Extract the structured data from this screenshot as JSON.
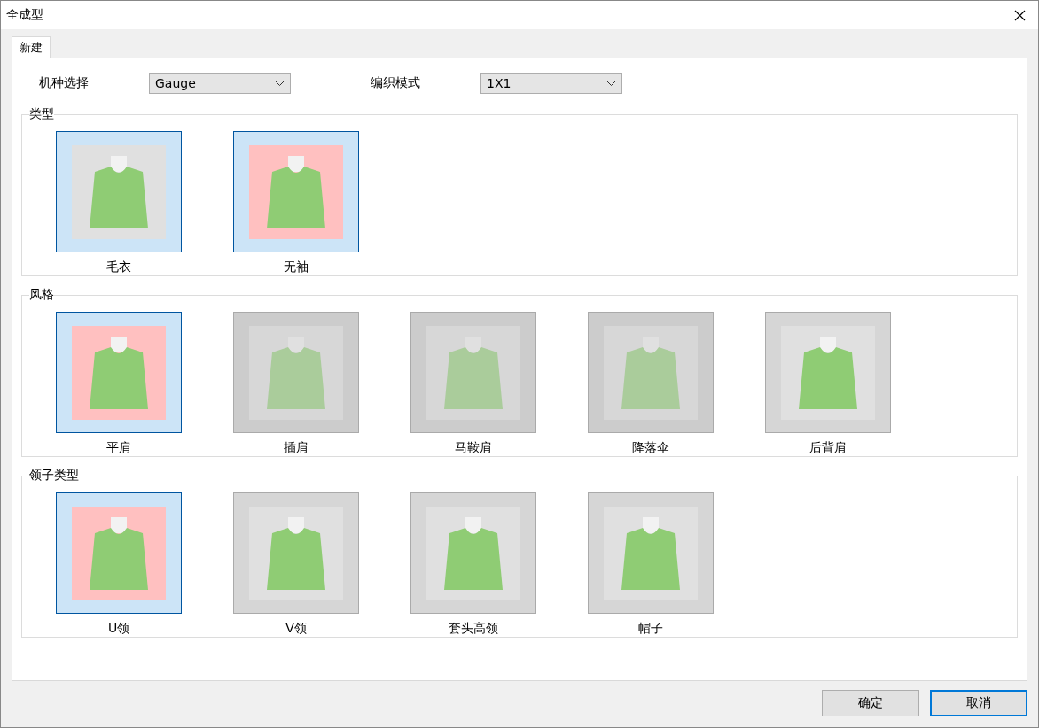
{
  "window": {
    "title": "全成型"
  },
  "tabs": [
    {
      "label": "新建",
      "selected": true
    }
  ],
  "fields": [
    {
      "label": "机种选择",
      "value": "Gauge"
    },
    {
      "label": "编织模式",
      "value": "1X1"
    }
  ],
  "groups": [
    {
      "title": "类型",
      "items": [
        {
          "label": "毛衣",
          "selected": true,
          "disabled": false,
          "color": "#e0e0e0"
        },
        {
          "label": "无袖",
          "selected": true,
          "disabled": false,
          "color": "#ffc0c0"
        }
      ]
    },
    {
      "title": "风格",
      "items": [
        {
          "label": "平肩",
          "selected": true,
          "disabled": false,
          "color": "#ffc0c0"
        },
        {
          "label": "插肩",
          "selected": false,
          "disabled": true,
          "color": "#e0e0e0"
        },
        {
          "label": "马鞍肩",
          "selected": false,
          "disabled": true,
          "color": "#e0e0e0"
        },
        {
          "label": "降落伞",
          "selected": false,
          "disabled": true,
          "color": "#e0e0e0"
        },
        {
          "label": "后背肩",
          "selected": false,
          "disabled": false,
          "color": "#e0e0e0"
        }
      ]
    },
    {
      "title": "领子类型",
      "items": [
        {
          "label": "U领",
          "selected": true,
          "disabled": false,
          "color": "#ffc0c0"
        },
        {
          "label": "V领",
          "selected": false,
          "disabled": false,
          "color": "#e0e0e0"
        },
        {
          "label": "套头高领",
          "selected": false,
          "disabled": false,
          "color": "#e0e0e0"
        },
        {
          "label": "帽子",
          "selected": false,
          "disabled": false,
          "color": "#e0e0e0"
        }
      ]
    }
  ],
  "buttons": [
    "确定",
    "取消"
  ]
}
